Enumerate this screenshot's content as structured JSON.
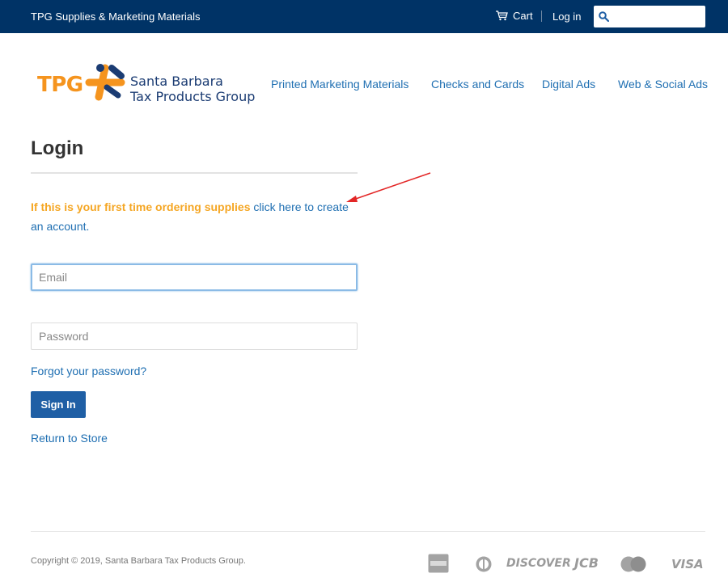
{
  "topbar": {
    "store_name": "TPG Supplies & Marketing Materials",
    "cart_label": "Cart",
    "login_label": "Log in",
    "search_placeholder": ""
  },
  "logo": {
    "short": "TPG",
    "line1": "Santa Barbara",
    "line2": "Tax Products Group"
  },
  "nav": {
    "items": [
      "Printed Marketing Materials",
      "Checks and Cards",
      "Digital Ads",
      "Web & Social Ads"
    ]
  },
  "main": {
    "title": "Login",
    "intro_warning": "If this is your first time ordering supplies",
    "intro_link": "click here to create an account.",
    "email_placeholder": "Email",
    "password_placeholder": "Password",
    "forgot_label": "Forgot your password?",
    "signin_label": "Sign In",
    "return_label": "Return to Store"
  },
  "footer": {
    "copyright": "Copyright © 2019, Santa Barbara Tax Products Group.",
    "payments": {
      "discover": "DISCOVER",
      "jcb": "JCB",
      "visa": "VISA"
    }
  },
  "colors": {
    "topbar_bg": "#003366",
    "link": "#1f6fb2",
    "warning": "#f5a623",
    "button": "#1f5fa5",
    "annotation_arrow": "#e32626"
  }
}
